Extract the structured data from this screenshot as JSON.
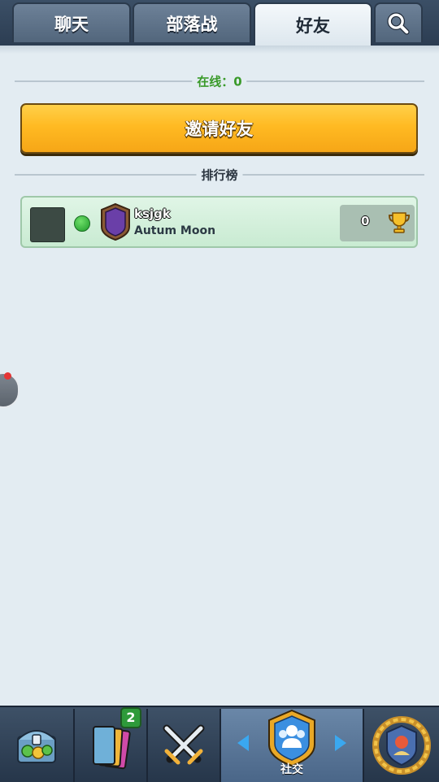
{
  "tabs": [
    {
      "label": "聊天"
    },
    {
      "label": "部落战"
    },
    {
      "label": "好友"
    }
  ],
  "search_icon": "search-icon",
  "online": {
    "label": "在线：0"
  },
  "invite_button": {
    "label": "邀请好友"
  },
  "leaderboard": {
    "label": "排行榜"
  },
  "friends": [
    {
      "name": "ksjgk",
      "clan": "Autum Moon",
      "trophies": "0",
      "status": "online",
      "badge_icon": "clan-shield-moon-icon"
    }
  ],
  "bottom_nav": {
    "items": [
      {
        "icon": "shop-chest-icon"
      },
      {
        "icon": "cards-icon",
        "badge": "2"
      },
      {
        "icon": "battle-swords-icon"
      },
      {
        "icon": "social-icon",
        "label": "社交"
      },
      {
        "icon": "events-laurel-icon"
      }
    ]
  },
  "colors": {
    "accent_yellow": "#ffba22",
    "online_green": "#3a9a2a",
    "header_blue": "#2c3d52"
  }
}
